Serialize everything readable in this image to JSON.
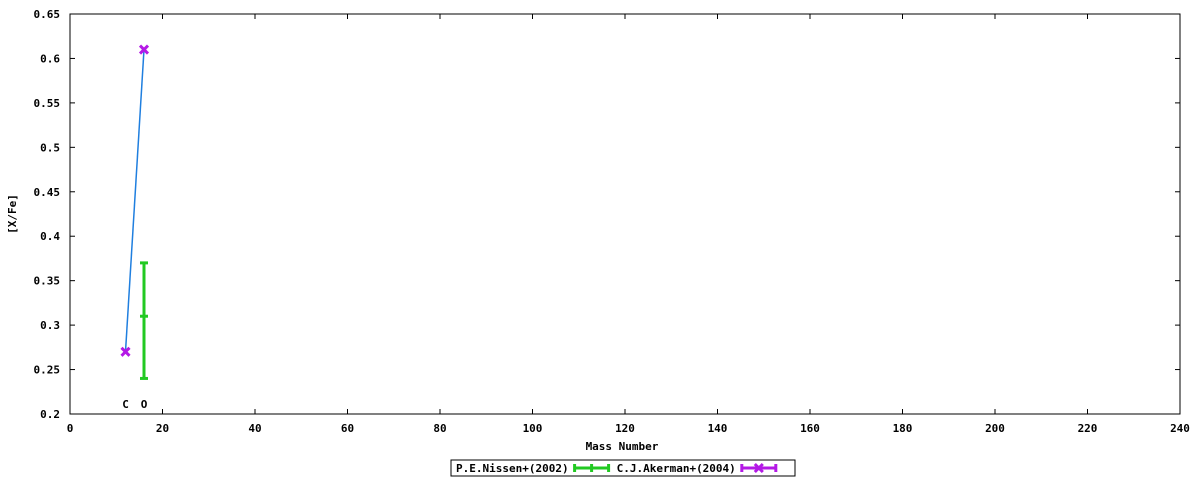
{
  "chart_data": {
    "type": "scatter",
    "title": "",
    "xlabel": "Mass Number",
    "ylabel": "[X/Fe]",
    "xlim": [
      0,
      240
    ],
    "ylim": [
      0.2,
      0.65
    ],
    "xticks": [
      0,
      20,
      40,
      60,
      80,
      100,
      120,
      140,
      160,
      180,
      200,
      220,
      240
    ],
    "yticks": [
      0.2,
      0.25,
      0.3,
      0.35,
      0.4,
      0.45,
      0.5,
      0.55,
      0.6,
      0.65
    ],
    "xtick_labels": [
      "0",
      "20",
      "40",
      "60",
      "80",
      "100",
      "120",
      "140",
      "160",
      "180",
      "200",
      "220",
      "240"
    ],
    "ytick_labels": [
      "0.2",
      "0.25",
      "0.3",
      "0.35",
      "0.4",
      "0.45",
      "0.5",
      "0.55",
      "0.6",
      "0.65"
    ],
    "grid": false,
    "legend_position": "bottom-center",
    "element_labels": [
      {
        "text": "C",
        "x": 12
      },
      {
        "text": "O",
        "x": 16
      }
    ],
    "model_line": {
      "color": "#1f7fdf",
      "points": [
        [
          12,
          0.27
        ],
        [
          16,
          0.61
        ]
      ]
    },
    "series": [
      {
        "name": "P.E.Nissen+(2002)",
        "color": "#22c922",
        "marker": "errorbar",
        "points": [
          {
            "x": 16,
            "y": 0.31,
            "ylow": 0.24,
            "yhigh": 0.37
          }
        ]
      },
      {
        "name": "C.J.Akerman+(2004)",
        "color": "#b419e6",
        "marker": "cross",
        "points": [
          {
            "x": 12,
            "y": 0.27
          },
          {
            "x": 16,
            "y": 0.61
          }
        ]
      }
    ]
  }
}
